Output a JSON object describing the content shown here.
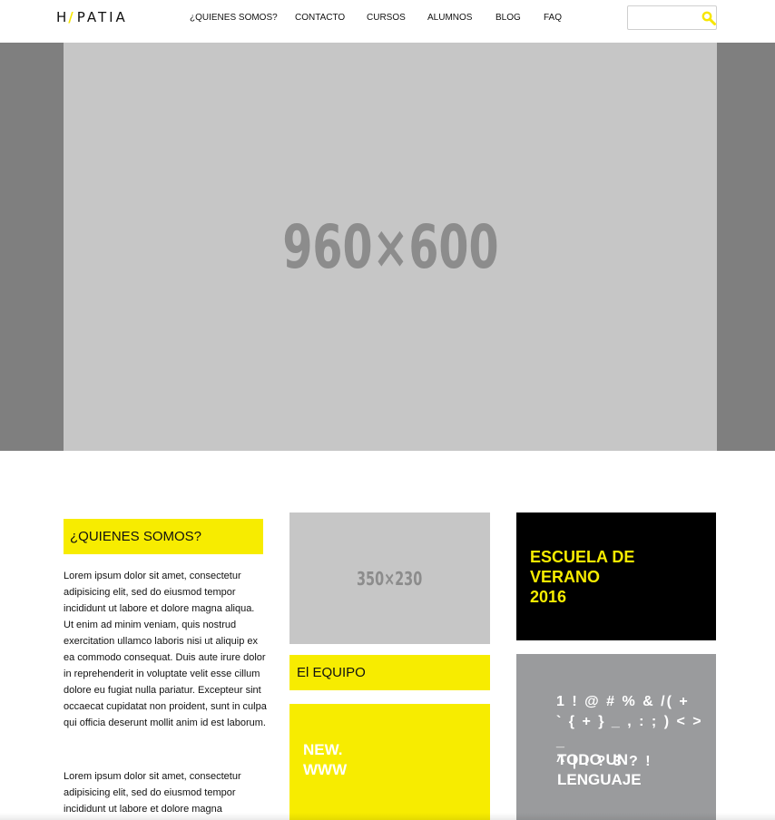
{
  "header": {
    "logo_left": "H",
    "logo_slash": "/",
    "logo_right": "PATIA",
    "nav": [
      {
        "label": "¿QUIENES SOMOS?"
      },
      {
        "label": "CONTACTO"
      },
      {
        "label": "CURSOS"
      },
      {
        "label": "ALUMNOS"
      },
      {
        "label": "BLOG"
      },
      {
        "label": "FAQ"
      }
    ],
    "search": {
      "value": "",
      "placeholder": ""
    }
  },
  "hero": {
    "placeholder_text": "960×600"
  },
  "quienes": {
    "title": "¿QUIENES SOMOS?",
    "paragraphs": [
      "Lorem ipsum dolor sit amet, consectetur adipisicing elit, sed do eiusmod tempor incididunt ut labore et dolore magna aliqua. Ut enim ad minim veniam, quis nostrud exercitation ullamco laboris nisi ut aliquip ex ea commodo consequat. Duis aute irure dolor in reprehenderit in voluptate velit esse cillum dolore eu fugiat nulla pariatur. Excepteur sint occaecat cupidatat non proident, sunt in culpa qui officia deserunt mollit anim id est laborum.",
      "Lorem ipsum dolor sit amet, consectetur adipisicing elit, sed do eiusmod tempor incididunt ut labore et dolore magna"
    ]
  },
  "equipo": {
    "image_placeholder": "350×230",
    "label": "El EQUIPO"
  },
  "new_www": {
    "label": "NEW.\nWWW"
  },
  "escuela": {
    "label": "ESCUELA DE\nVERANO\n2016"
  },
  "lenguaje": {
    "symbols": "1 ! @ # % & /( +\n` { + } _ , : ; ) < > _\n^ | ! ? 3 ? !",
    "tagline": "TODO UN\nLENGUAJE"
  },
  "colors": {
    "accent_yellow": "#f7ec00",
    "hero_bg": "#7f7f7f",
    "placeholder_gray": "#c6c6c6",
    "tile_gray": "#9a9b9d"
  },
  "icons": {
    "search": "search-icon"
  }
}
